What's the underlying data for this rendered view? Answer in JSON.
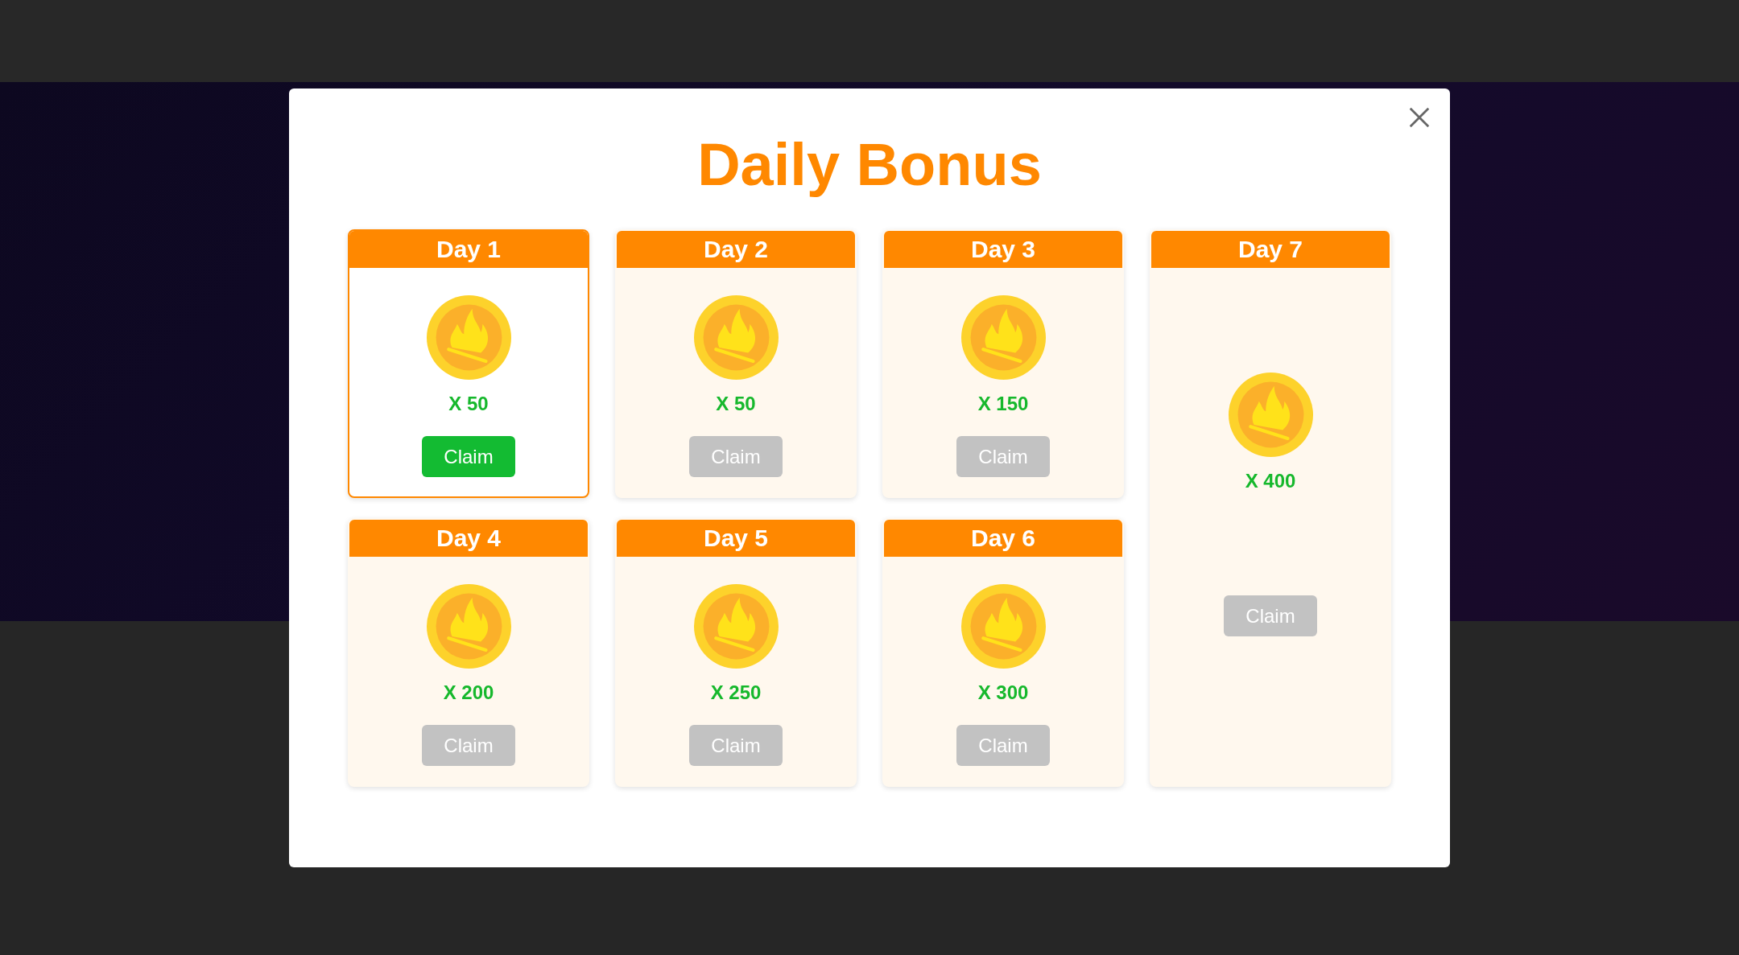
{
  "dialog": {
    "title": "Daily Bonus",
    "days": [
      {
        "kind": "regular",
        "label": "Day 1",
        "amount": "X 50",
        "button": "Claim",
        "claimable": true
      },
      {
        "kind": "regular",
        "label": "Day 2",
        "amount": "X 50",
        "button": "Claim",
        "claimable": false
      },
      {
        "kind": "regular",
        "label": "Day 3",
        "amount": "X 150",
        "button": "Claim",
        "claimable": false
      },
      {
        "kind": "grand",
        "label": "Day 7",
        "amount": "X 400",
        "button": "Claim",
        "claimable": false
      },
      {
        "kind": "regular",
        "label": "Day 4",
        "amount": "X 200",
        "button": "Claim",
        "claimable": false
      },
      {
        "kind": "regular",
        "label": "Day 5",
        "amount": "X 250",
        "button": "Claim",
        "claimable": false
      },
      {
        "kind": "regular",
        "label": "Day 6",
        "amount": "X 300",
        "button": "Claim",
        "claimable": false
      }
    ]
  }
}
